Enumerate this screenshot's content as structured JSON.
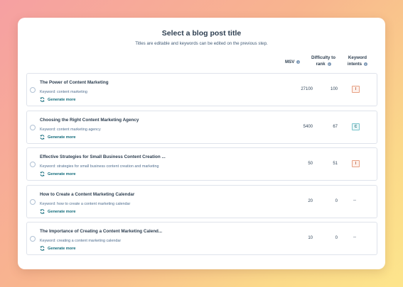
{
  "header": {
    "title": "Select a blog post title",
    "subtitle": "Titles are editable and keywords can be edited on the previous step."
  },
  "columns": {
    "msv": "MSV",
    "difficulty": "Difficulty to rank",
    "difficulty_line1": "Difficulty to",
    "difficulty_line2": "rank",
    "intents": "Keyword intents",
    "intents_line1": "Keyword",
    "intents_line2": "intents"
  },
  "rows": [
    {
      "title": "The Power of Content Marketing",
      "keyword": "Keyword: content marketing",
      "generate": "Generate more",
      "msv": "27100",
      "difficulty": "100",
      "intent": "I"
    },
    {
      "title": "Choosing the Right Content Marketing Agency",
      "keyword": "Keyword: content marketing agency",
      "generate": "Generate more",
      "msv": "5400",
      "difficulty": "67",
      "intent": "C"
    },
    {
      "title": "Effective Strategies for Small Business Content Creation ...",
      "keyword": "Keyword: strategies for small business content creation and marketing",
      "generate": "Generate more",
      "msv": "50",
      "difficulty": "51",
      "intent": "I"
    },
    {
      "title": "How to Create a Content Marketing Calendar",
      "keyword": "Keyword: how to create a content marketing calendar",
      "generate": "Generate more",
      "msv": "20",
      "difficulty": "0",
      "intent": "--"
    },
    {
      "title": "The Importance of Creating a Content Marketing Calend...",
      "keyword": "Keyword: creating a content marketing calendar",
      "generate": "Generate more",
      "msv": "10",
      "difficulty": "0",
      "intent": "--"
    }
  ],
  "icons": {
    "info": "info-icon",
    "generate": "refresh-icon",
    "radio": "radio-button"
  },
  "colors": {
    "accent": "#0f6a7a",
    "intent_informational": "#b5522f",
    "intent_commercial": "#1f6f78"
  }
}
